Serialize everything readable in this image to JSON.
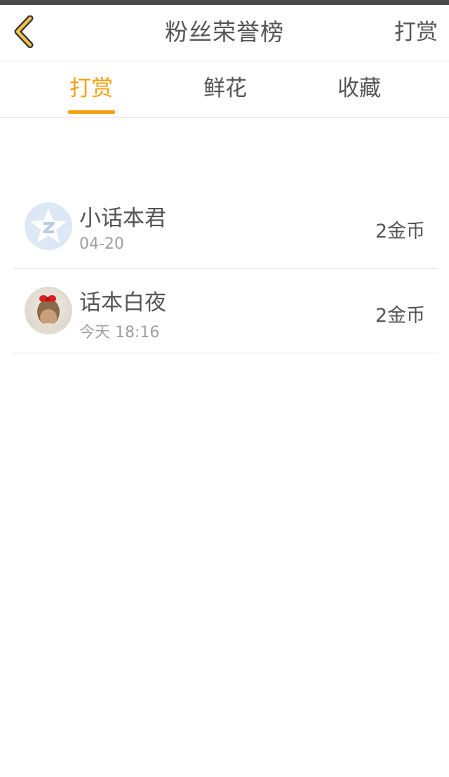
{
  "nav": {
    "title": "粉丝荣誉榜",
    "action_label": "打赏",
    "back_icon": "chevron-left-icon",
    "accent_color": "#f5a00e"
  },
  "tabs": [
    {
      "label": "打赏",
      "active": true
    },
    {
      "label": "鲜花",
      "active": false
    },
    {
      "label": "收藏",
      "active": false
    }
  ],
  "list": [
    {
      "name": "小话本君",
      "time": "04-20",
      "amount": "2金币",
      "avatar": "default-star-avatar"
    },
    {
      "name": "话本白夜",
      "time": "今天 18:16",
      "amount": "2金币",
      "avatar": "user-photo-avatar"
    }
  ]
}
